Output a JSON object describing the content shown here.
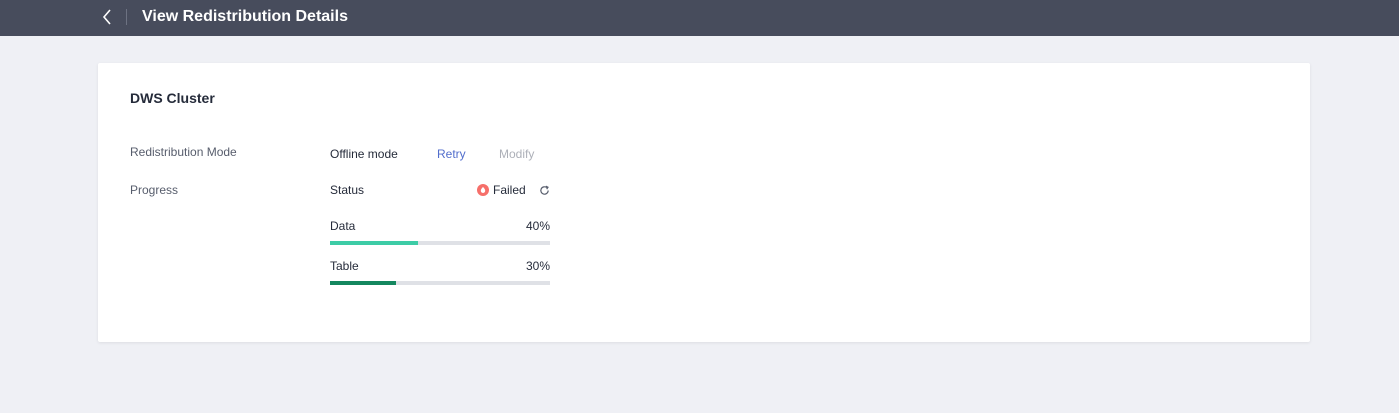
{
  "header": {
    "title": "View Redistribution Details",
    "back_icon": "chevron-left-icon"
  },
  "card": {
    "title": "DWS Cluster",
    "mode": {
      "label": "Redistribution Mode",
      "value": "Offline mode",
      "retry_label": "Retry",
      "modify_label": "Modify"
    },
    "progress": {
      "label": "Progress",
      "status_label": "Status",
      "status_value": "Failed",
      "status_color": "#f66f6a",
      "items": [
        {
          "label": "Data",
          "percent_text": "40%",
          "percent": 40,
          "color": "#3dcca6"
        },
        {
          "label": "Table",
          "percent_text": "30%",
          "percent": 30,
          "color": "#14875f"
        }
      ]
    }
  }
}
